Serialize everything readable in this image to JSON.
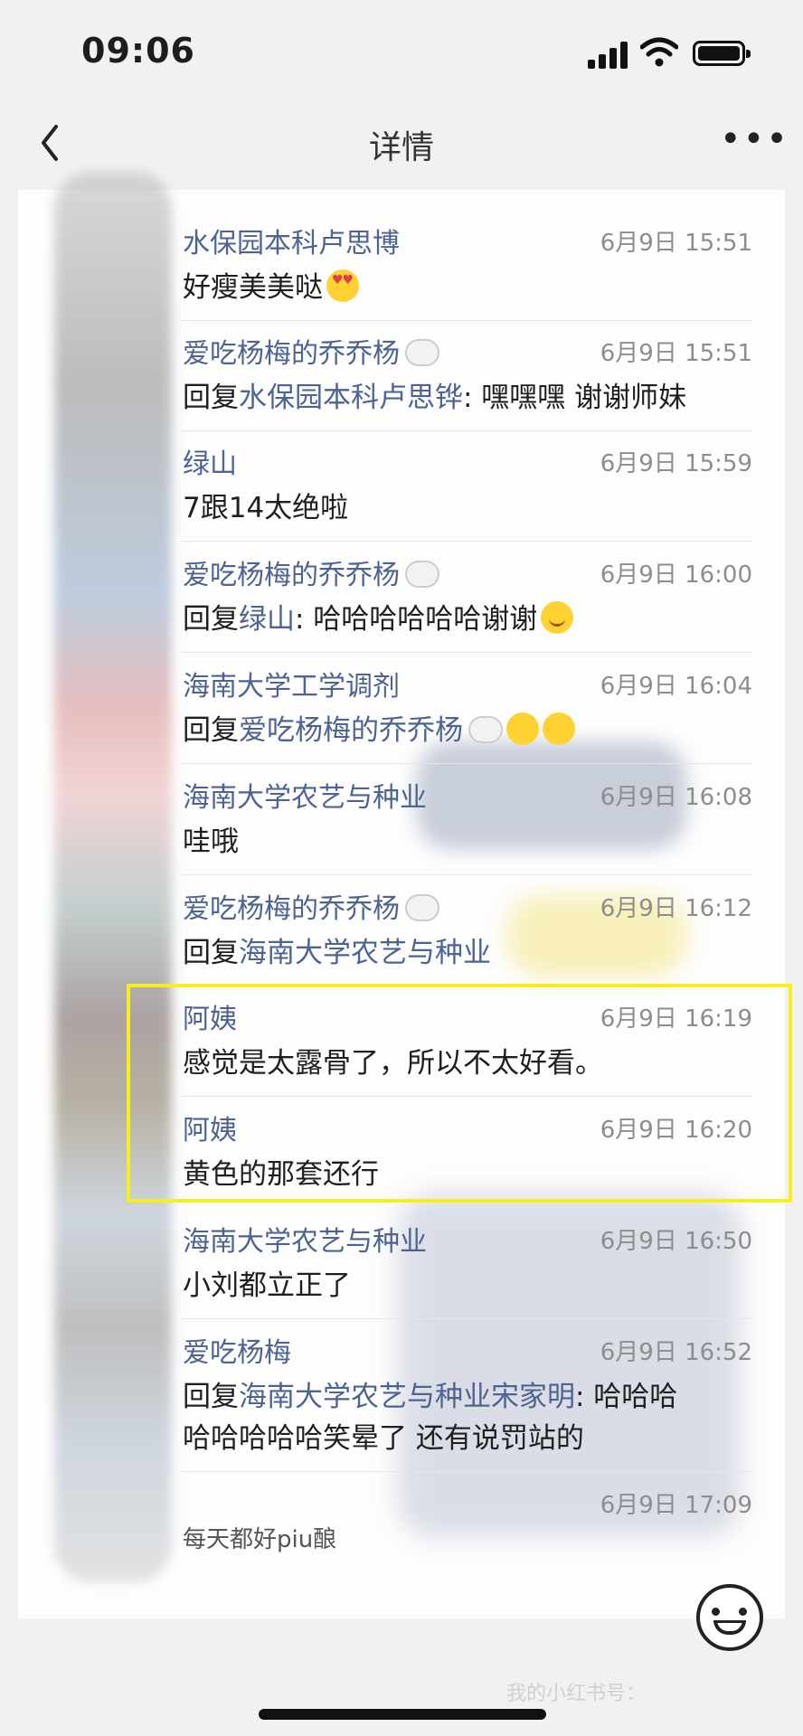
{
  "status_bar": {
    "time": "09:06"
  },
  "nav": {
    "title": "详情"
  },
  "comments": [
    {
      "name": "水保园本科卢思博",
      "time": "6月9日 15:51",
      "text": "好瘦美美哒"
    },
    {
      "name": "爱吃杨梅的乔乔杨",
      "time": "6月9日 15:51",
      "text_prefix": "回复",
      "text_ref": "水保园本科卢思铧",
      "text_suffix": ": 嘿嘿嘿 谢谢师妹"
    },
    {
      "name": "绿山",
      "time": "6月9日 15:59",
      "text": "7跟14太绝啦"
    },
    {
      "name": "爱吃杨梅的乔乔杨",
      "time": "6月9日 16:00",
      "text_prefix": "回复",
      "text_ref": "绿山",
      "text_suffix": ": 哈哈哈哈哈哈谢谢"
    },
    {
      "name": "海南大学工学调剂",
      "time": "6月9日 16:04",
      "text_prefix": "回复",
      "text_ref": "爱吃杨梅的乔乔杨",
      "text_suffix": ""
    },
    {
      "name": "海南大学农艺与种业",
      "time": "6月9日 16:08",
      "text": "哇哦"
    },
    {
      "name": "爱吃杨梅的乔乔杨",
      "time": "6月9日 16:12",
      "text_prefix": "回复",
      "text_ref": "海南大学农艺与种业",
      "text_suffix": ""
    },
    {
      "name": "阿姨",
      "time": "6月9日 16:19",
      "text": "感觉是太露骨了，所以不太好看。"
    },
    {
      "name": "阿姨",
      "time": "6月9日 16:20",
      "text": "黄色的那套还行"
    },
    {
      "name": "海南大学农艺与种业",
      "time": "6月9日 16:50",
      "text": "小刘都立正了"
    },
    {
      "name": "爱吃杨梅",
      "time": "6月9日 16:52",
      "text_prefix": "回复",
      "text_ref": "海南大学农艺与种业宋家明",
      "text_suffix": ": 哈哈哈",
      "text_line2": "哈哈哈哈哈笑晕了 还有说罚站的"
    },
    {
      "name": "",
      "time": "6月9日 17:09",
      "text": "每天都好piu酿"
    }
  ],
  "watermark": "我的小红书号：",
  "colors": {
    "highlight": "#f6ef20",
    "name": "#4d6491",
    "time": "#8d8d8d"
  }
}
